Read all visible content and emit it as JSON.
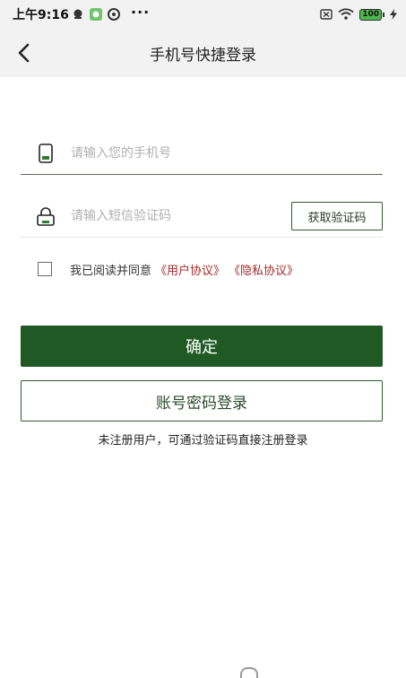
{
  "status_bar": {
    "time": "上午9:16",
    "more": "···",
    "battery": "100",
    "icons": [
      "notification-icon",
      "wechat-icon",
      "app-icon",
      "sim-off-icon",
      "wifi-icon",
      "battery-icon",
      "charging-icon"
    ]
  },
  "nav": {
    "title": "手机号快捷登录"
  },
  "form": {
    "phone_placeholder": "请输入您的手机号",
    "code_placeholder": "请输入短信验证码",
    "get_code_label": "获取验证码",
    "agree_prefix": "我已阅读并同意",
    "user_agreement": "《用户协议》",
    "privacy_policy": "《隐私协议》",
    "checked": false
  },
  "actions": {
    "confirm_label": "确定",
    "password_login_label": "账号密码登录"
  },
  "hint": "未注册用户，可通过验证码直接注册登录",
  "colors": {
    "primary": "#1f5a24",
    "link": "#a52a2a",
    "header_bg": "#f2f2f2"
  }
}
